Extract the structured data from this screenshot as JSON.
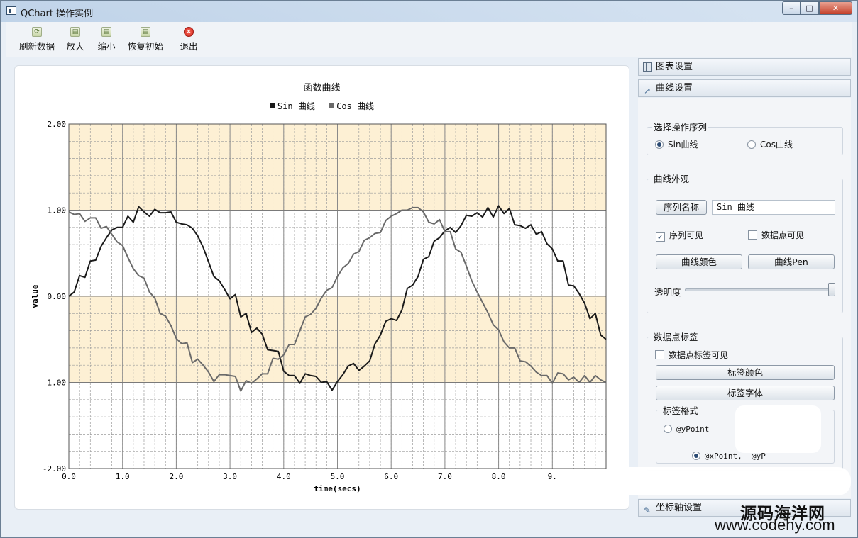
{
  "window": {
    "title": "QChart 操作实例",
    "min": "–",
    "max": "□",
    "close": "✕"
  },
  "toolbar": [
    {
      "label": "刷新数据",
      "icon": "refresh-icon"
    },
    {
      "label": "放大",
      "icon": "zoom-in-icon"
    },
    {
      "label": "缩小",
      "icon": "zoom-out-icon"
    },
    {
      "label": "恢复初始",
      "icon": "reset-icon"
    },
    {
      "label": "退出",
      "icon": "exit-icon"
    }
  ],
  "chart_data": {
    "type": "line",
    "title": "函数曲线",
    "xlabel": "time(secs)",
    "ylabel": "value",
    "xlim": [
      0,
      10
    ],
    "ylim": [
      -2,
      2
    ],
    "x_ticks": [
      "0.0",
      "1.0",
      "2.0",
      "3.0",
      "4.0",
      "5.0",
      "6.0",
      "7.0",
      "8.0",
      "9."
    ],
    "y_ticks": [
      "2.00",
      "1.00",
      "0.00",
      "-1.00",
      "-2.00"
    ],
    "legend": "top",
    "grid": true,
    "shaded_bands": [
      [
        1,
        2
      ],
      [
        -1,
        0
      ]
    ],
    "x": [
      0,
      0.1,
      0.2,
      0.3,
      0.4,
      0.5,
      0.6,
      0.7,
      0.8,
      0.9,
      1.0,
      1.1,
      1.2,
      1.3,
      1.4,
      1.5,
      1.6,
      1.7,
      1.8,
      1.9,
      2.0,
      2.1,
      2.2,
      2.3,
      2.4,
      2.5,
      2.6,
      2.7,
      2.8,
      2.9,
      3.0,
      3.1,
      3.2,
      3.3,
      3.4,
      3.5,
      3.6,
      3.7,
      3.8,
      3.9,
      4.0,
      4.1,
      4.2,
      4.3,
      4.4,
      4.5,
      4.6,
      4.7,
      4.8,
      4.9,
      5.0,
      5.1,
      5.2,
      5.3,
      5.4,
      5.5,
      5.6,
      5.7,
      5.8,
      5.9,
      6.0,
      6.1,
      6.2,
      6.3,
      6.4,
      6.5,
      6.6,
      6.7,
      6.8,
      6.9,
      7.0,
      7.1,
      7.2,
      7.3,
      7.4,
      7.5,
      7.6,
      7.7,
      7.8,
      7.9,
      8.0,
      8.1,
      8.2,
      8.3,
      8.4,
      8.5,
      8.6,
      8.7,
      8.8,
      8.9,
      9.0,
      9.1,
      9.2,
      9.3,
      9.4,
      9.5,
      9.6,
      9.7,
      9.8,
      9.9,
      10.0
    ],
    "series": [
      {
        "name": "Sin 曲线",
        "color": "#1a1a1a",
        "values": [
          0.0,
          0.05,
          0.24,
          0.22,
          0.41,
          0.42,
          0.58,
          0.68,
          0.77,
          0.8,
          0.8,
          0.93,
          0.86,
          1.04,
          0.98,
          0.93,
          1.01,
          0.97,
          0.97,
          0.98,
          0.86,
          0.84,
          0.83,
          0.79,
          0.7,
          0.57,
          0.4,
          0.23,
          0.18,
          0.08,
          -0.03,
          0.02,
          -0.24,
          -0.2,
          -0.42,
          -0.37,
          -0.44,
          -0.62,
          -0.63,
          -0.64,
          -0.87,
          -0.92,
          -0.92,
          -1.01,
          -0.9,
          -0.92,
          -0.93,
          -1.0,
          -0.99,
          -1.09,
          -0.99,
          -0.91,
          -0.81,
          -0.78,
          -0.86,
          -0.81,
          -0.75,
          -0.55,
          -0.45,
          -0.29,
          -0.26,
          -0.28,
          -0.16,
          0.09,
          0.13,
          0.23,
          0.43,
          0.46,
          0.64,
          0.68,
          0.76,
          0.8,
          0.74,
          0.82,
          0.94,
          0.93,
          0.97,
          0.92,
          1.03,
          0.92,
          1.05,
          0.96,
          1.02,
          0.83,
          0.82,
          0.79,
          0.83,
          0.72,
          0.75,
          0.61,
          0.55,
          0.41,
          0.41,
          0.13,
          0.12,
          0.03,
          -0.08,
          -0.26,
          -0.2,
          -0.45,
          -0.5
        ]
      },
      {
        "name": "Cos 曲线",
        "color": "#6a6a6a",
        "values": [
          0.98,
          0.95,
          0.96,
          0.87,
          0.91,
          0.91,
          0.79,
          0.81,
          0.72,
          0.63,
          0.59,
          0.45,
          0.32,
          0.24,
          0.21,
          0.05,
          -0.02,
          -0.2,
          -0.23,
          -0.34,
          -0.49,
          -0.55,
          -0.54,
          -0.77,
          -0.73,
          -0.8,
          -0.88,
          -0.99,
          -0.91,
          -0.91,
          -0.92,
          -0.93,
          -1.1,
          -0.98,
          -1.01,
          -0.96,
          -0.9,
          -0.9,
          -0.72,
          -0.73,
          -0.68,
          -0.56,
          -0.56,
          -0.4,
          -0.24,
          -0.21,
          -0.14,
          -0.02,
          0.07,
          0.1,
          0.23,
          0.33,
          0.38,
          0.49,
          0.52,
          0.65,
          0.68,
          0.73,
          0.74,
          0.88,
          0.93,
          0.96,
          1.0,
          1.0,
          1.03,
          1.03,
          0.98,
          0.86,
          0.84,
          0.89,
          0.75,
          0.75,
          0.55,
          0.51,
          0.35,
          0.18,
          0.05,
          -0.07,
          -0.19,
          -0.33,
          -0.39,
          -0.53,
          -0.6,
          -0.6,
          -0.75,
          -0.76,
          -0.81,
          -0.88,
          -0.92,
          -0.92,
          -1.01,
          -0.89,
          -0.9,
          -0.97,
          -0.94,
          -1.0,
          -0.92,
          -1.0,
          -0.92,
          -0.97,
          -1.0
        ]
      }
    ]
  },
  "dock": {
    "tabs": [
      "图表设置",
      "曲线设置",
      "坐标轴设置"
    ],
    "series_group": {
      "title": "选择操作序列",
      "options": [
        "Sin曲线",
        "Cos曲线"
      ],
      "selected": 0
    },
    "appearance_group": {
      "title": "曲线外观",
      "name_button": "序列名称",
      "name_value": "Sin 曲线",
      "visible_label": "序列可见",
      "visible_checked": true,
      "points_visible_label": "数据点可见",
      "points_visible_checked": false,
      "color_button": "曲线颜色",
      "pen_button": "曲线Pen",
      "opacity_label": "透明度",
      "opacity": 1.0
    },
    "labels_group": {
      "title": "数据点标签",
      "labels_visible_label": "数据点标签可见",
      "labels_visible_checked": false,
      "label_color_button": "标签颜色",
      "label_font_button": "标签字体",
      "format_title": "标签格式",
      "format_options": [
        "@yPoint",
        "@xPoint,  @yP"
      ],
      "format_selected": 1
    }
  },
  "watermark": {
    "cn": "源码海洋网",
    "url": "www.codehy.com"
  }
}
